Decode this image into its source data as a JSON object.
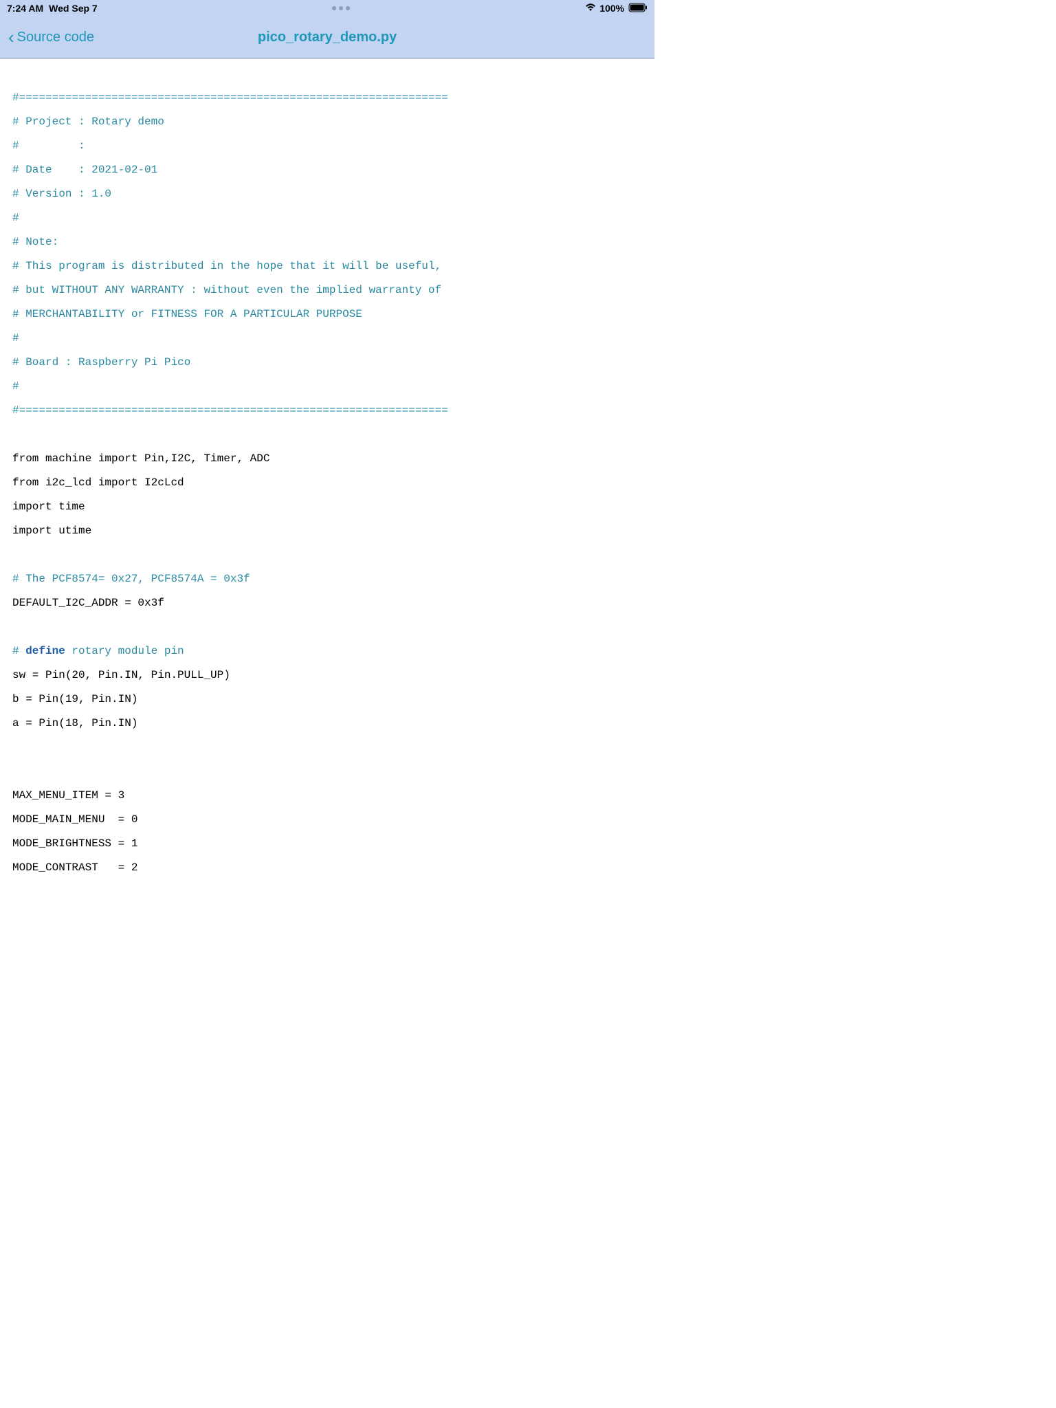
{
  "statusBar": {
    "time": "7:24 AM",
    "date": "Wed Sep 7",
    "battery": "100%"
  },
  "navBar": {
    "backLabel": "Source code",
    "title": "pico_rotary_demo.py"
  },
  "code": {
    "lines": [
      {
        "type": "comment",
        "text": "#================================================================="
      },
      {
        "type": "comment",
        "text": "# Project : Rotary demo"
      },
      {
        "type": "comment",
        "text": "#         :"
      },
      {
        "type": "comment",
        "text": "# Date    : 2021-02-01"
      },
      {
        "type": "comment",
        "text": "# Version : 1.0"
      },
      {
        "type": "comment",
        "text": "#"
      },
      {
        "type": "comment",
        "text": "# Note:"
      },
      {
        "type": "comment",
        "text": "# This program is distributed in the hope that it will be useful,"
      },
      {
        "type": "comment",
        "text": "# but WITHOUT ANY WARRANTY : without even the implied warranty of"
      },
      {
        "type": "comment",
        "text": "# MERCHANTABILITY or FITNESS FOR A PARTICULAR PURPOSE"
      },
      {
        "type": "comment",
        "text": "#"
      },
      {
        "type": "comment",
        "text": "# Board : Raspberry Pi Pico"
      },
      {
        "type": "comment",
        "text": "#"
      },
      {
        "type": "comment",
        "text": "#================================================================="
      },
      {
        "type": "blank",
        "text": ""
      },
      {
        "type": "code",
        "text": "from machine import Pin,I2C, Timer, ADC"
      },
      {
        "type": "code",
        "text": "from i2c_lcd import I2cLcd"
      },
      {
        "type": "code",
        "text": "import time"
      },
      {
        "type": "code",
        "text": "import utime"
      },
      {
        "type": "blank",
        "text": ""
      },
      {
        "type": "comment",
        "text": "# The PCF8574= 0x27, PCF8574A = 0x3f"
      },
      {
        "type": "code",
        "text": "DEFAULT_I2C_ADDR = 0x3f"
      },
      {
        "type": "blank",
        "text": ""
      },
      {
        "type": "mixed",
        "prefix": "# ",
        "keyword": "define",
        "suffix": " rotary module pin"
      },
      {
        "type": "code",
        "text": "sw = Pin(20, Pin.IN, Pin.PULL_UP)"
      },
      {
        "type": "code",
        "text": "b = Pin(19, Pin.IN)"
      },
      {
        "type": "code",
        "text": "a = Pin(18, Pin.IN)"
      },
      {
        "type": "blank",
        "text": ""
      },
      {
        "type": "blank",
        "text": ""
      },
      {
        "type": "code",
        "text": "MAX_MENU_ITEM = 3"
      },
      {
        "type": "code",
        "text": "MODE_MAIN_MENU  = 0"
      },
      {
        "type": "code",
        "text": "MODE_BRIGHTNESS = 1"
      },
      {
        "type": "code",
        "text": "MODE_CONTRAST   = 2"
      }
    ]
  }
}
